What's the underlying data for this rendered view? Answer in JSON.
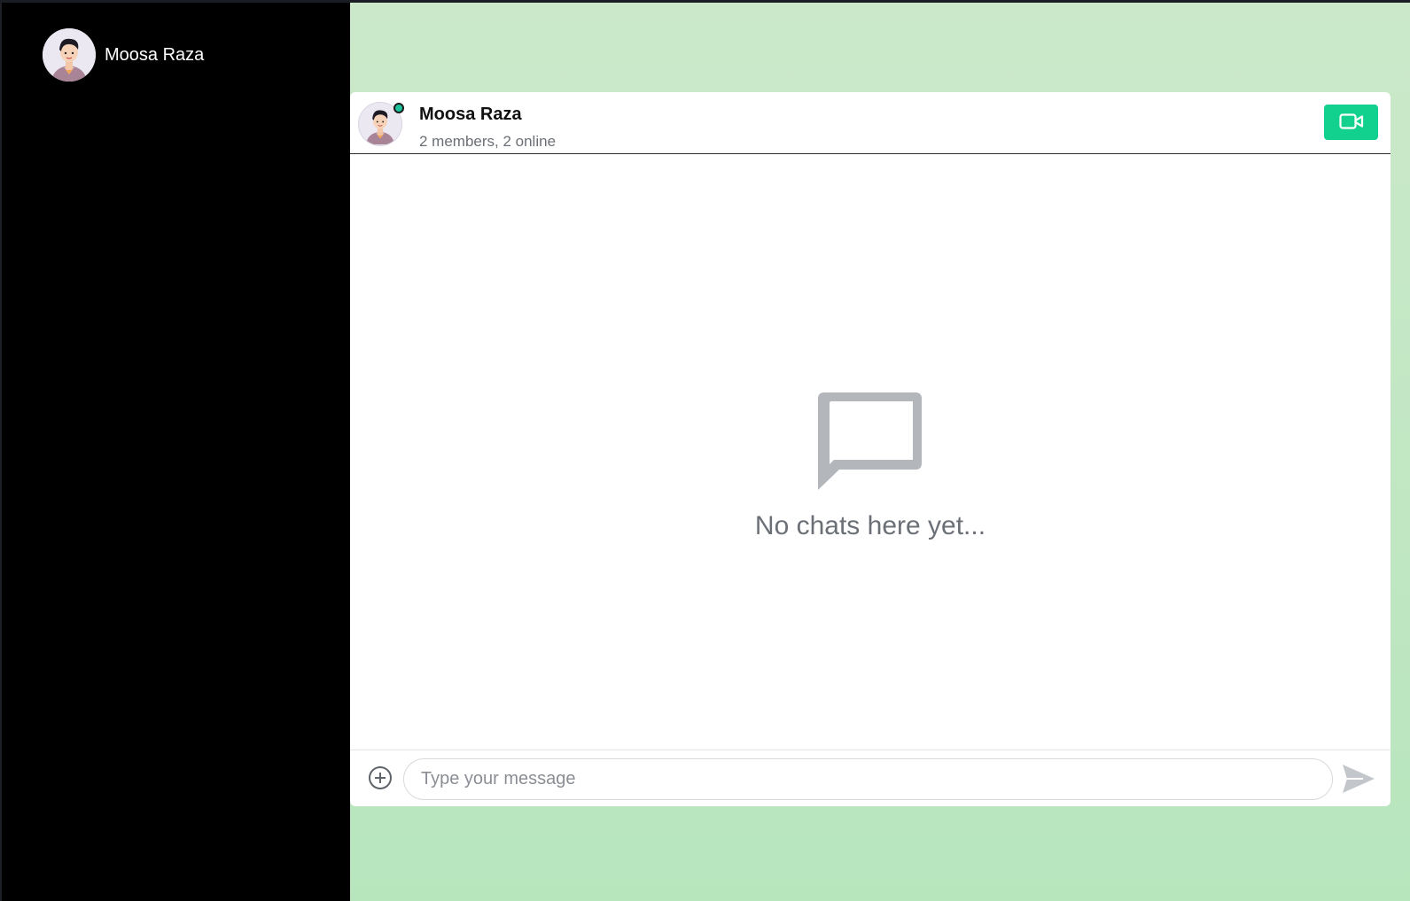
{
  "sidebar": {
    "user_name": "Moosa Raza"
  },
  "chat": {
    "title": "Moosa Raza",
    "subtitle": "2 members, 2 online",
    "empty_message": "No chats here yet..."
  },
  "composer": {
    "placeholder": "Type your message"
  },
  "colors": {
    "accent": "#12d18e",
    "online": "#1cc39b",
    "sidebar_bg": "#000000",
    "main_bg": "#c2e7c3"
  },
  "icons": {
    "video": "video-camera-icon",
    "empty": "chat-bubble-icon",
    "attach": "plus-circle-icon",
    "send": "send-icon"
  }
}
